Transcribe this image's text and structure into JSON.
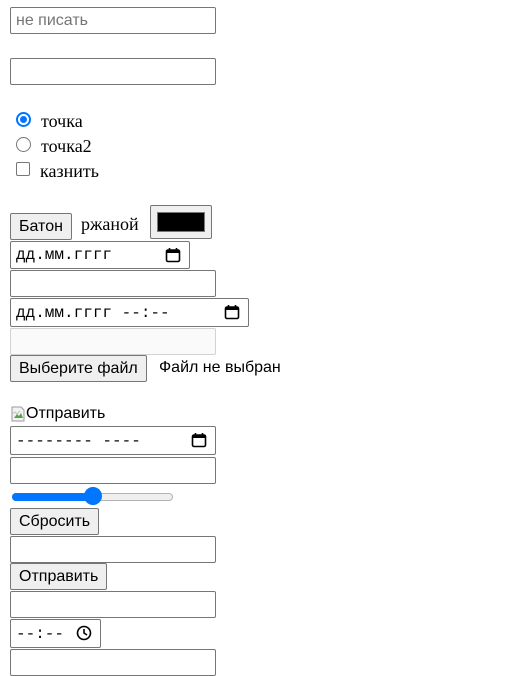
{
  "text_input_1": {
    "placeholder": "не писать",
    "value": ""
  },
  "text_input_2": {
    "value": ""
  },
  "radio_group": [
    {
      "label": "точка",
      "checked": true
    },
    {
      "label": "точка2",
      "checked": false
    }
  ],
  "checkbox": {
    "label": "казнить",
    "checked": false
  },
  "button_baton": {
    "label": "Батон"
  },
  "rye_label": "ржаной",
  "color_input": {
    "value": "#000000"
  },
  "date_input": {
    "value": "дд.мм.гггг"
  },
  "text_input_3": {
    "value": ""
  },
  "datetime_input": {
    "value": "дд.мм.гггг --:--"
  },
  "disabled_input": {
    "value": ""
  },
  "file_input": {
    "button_label": "Выберите файл",
    "status": "Файл не выбран"
  },
  "image_submit": {
    "alt": "Отправить"
  },
  "week_input": {
    "value": "-------- ----"
  },
  "text_input_4": {
    "value": ""
  },
  "range_input": {
    "value": 50,
    "min": 0,
    "max": 100,
    "accent": "#0075ff"
  },
  "reset_button": {
    "label": "Сбросить"
  },
  "text_input_5": {
    "value": ""
  },
  "submit_button": {
    "label": "Отправить"
  },
  "text_input_6": {
    "value": ""
  },
  "time_input": {
    "value": "--:--"
  },
  "text_input_7": {
    "value": ""
  }
}
